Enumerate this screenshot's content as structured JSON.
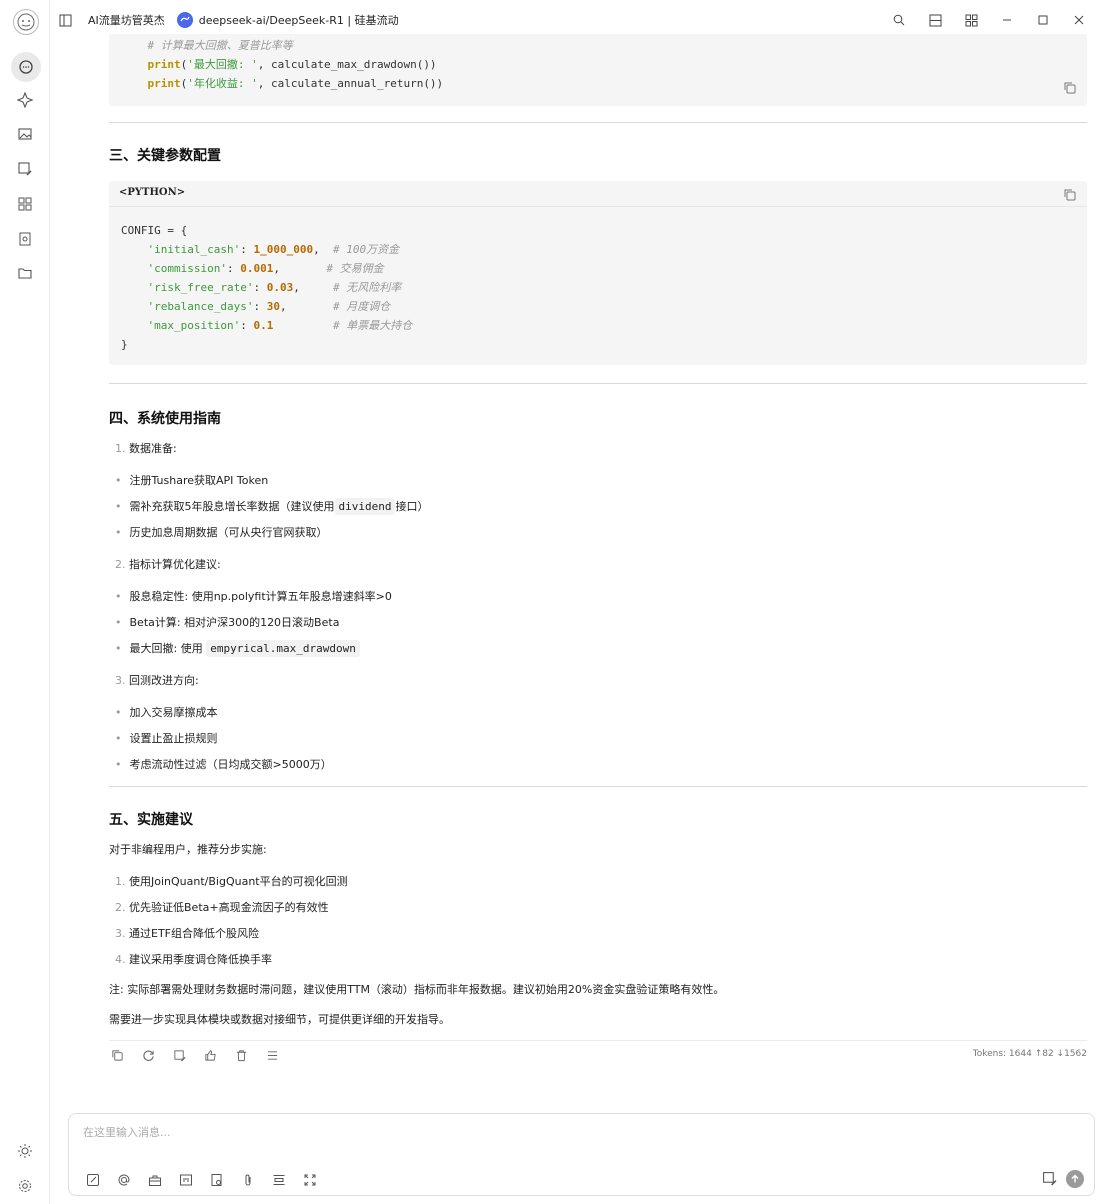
{
  "window": {
    "title": "AI流量坊管英杰",
    "tab_title": "deepseek-ai/DeepSeek-R1 | 硅基流动"
  },
  "code_top": {
    "line1": "    # 计算最大回撤、夏普比率等",
    "line2_fn": "print",
    "line2_str": "'最大回撤: '",
    "line2_rest": ", calculate_max_drawdown())",
    "line3_fn": "print",
    "line3_str": "'年化收益: '",
    "line3_rest": ", calculate_annual_return())"
  },
  "section3": {
    "title": "三、关键参数配置",
    "lang": "<PYTHON>",
    "code_open": "CONFIG = {",
    "rows": [
      {
        "key": "'initial_cash'",
        "val": "1_000_000",
        "sep": ",  ",
        "comment": "# 100万资金"
      },
      {
        "key": "'commission'",
        "val": "0.001",
        "sep": ",       ",
        "comment": "# 交易佣金"
      },
      {
        "key": "'risk_free_rate'",
        "val": "0.03",
        "sep": ",     ",
        "comment": "# 无风险利率"
      },
      {
        "key": "'rebalance_days'",
        "val": "30",
        "sep": ",       ",
        "comment": "# 月度调仓"
      },
      {
        "key": "'max_position'",
        "val": "0.1",
        "sep": "         ",
        "comment": "# 单票最大持仓"
      }
    ],
    "code_close": "}"
  },
  "section4": {
    "title": "四、系统使用指南",
    "g1_num": "1.",
    "g1_title": "数据准备:",
    "g1_b1": "注册Tushare获取API Token",
    "g1_b2_pre": "需补充获取5年股息增长率数据（建议使用",
    "g1_b2_code": "dividend",
    "g1_b2_post": "接口）",
    "g1_b3": "历史加息周期数据（可从央行官网获取）",
    "g2_num": "2.",
    "g2_title": "指标计算优化建议:",
    "g2_b1": "股息稳定性: 使用np.polyfit计算五年股息增速斜率>0",
    "g2_b2": "Beta计算: 相对沪深300的120日滚动Beta",
    "g2_b3_pre": "最大回撤: 使用",
    "g2_b3_code": "empyrical.max_drawdown",
    "g3_num": "3.",
    "g3_title": "回测改进方向:",
    "g3_b1": "加入交易摩擦成本",
    "g3_b2": "设置止盈止损规则",
    "g3_b3": "考虑流动性过滤（日均成交额>5000万）"
  },
  "section5": {
    "title": "五、实施建议",
    "intro": "对于非编程用户，推荐分步实施:",
    "items": [
      {
        "n": "1.",
        "t": "使用JoinQuant/BigQuant平台的可视化回测"
      },
      {
        "n": "2.",
        "t": "优先验证低Beta+高现金流因子的有效性"
      },
      {
        "n": "3.",
        "t": "通过ETF组合降低个股风险"
      },
      {
        "n": "4.",
        "t": "建议采用季度调仓降低换手率"
      }
    ],
    "note": "注: 实际部署需处理财务数据时滞问题，建议使用TTM（滚动）指标而非年报数据。建议初始用20%资金实盘验证策略有效性。",
    "closing": "需要进一步实现具体模块或数据对接细节，可提供更详细的开发指导。"
  },
  "tokens": "Tokens: 1644 ↑82 ↓1562",
  "input": {
    "placeholder": "在这里输入消息..."
  }
}
